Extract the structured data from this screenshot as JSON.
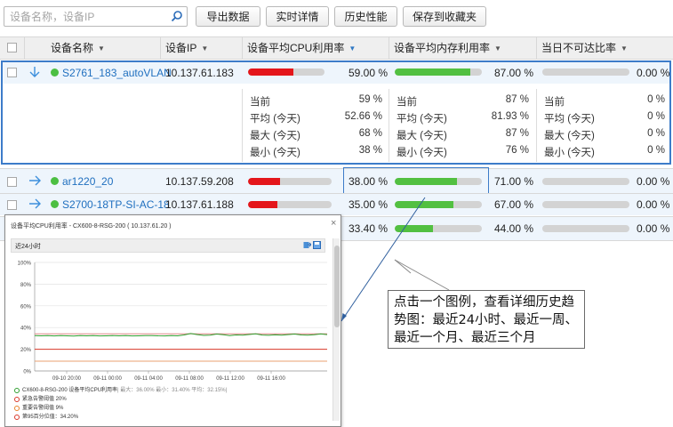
{
  "toolbar": {
    "search_placeholder": "设备名称，设备IP",
    "buttons": [
      "导出数据",
      "实时详情",
      "历史性能",
      "保存到收藏夹"
    ]
  },
  "columns": {
    "name": "设备名称",
    "ip": "设备IP",
    "cpu": "设备平均CPU利用率",
    "mem": "设备平均内存利用率",
    "unreach": "当日不可达比率"
  },
  "rows": [
    {
      "name": "S2761_183_autoVLAN",
      "ip": "10.137.61.183",
      "cpu_pct": 59,
      "cpu": "59.00 %",
      "mem_pct": 87,
      "mem": "87.00 %",
      "unreach": "0.00 %"
    },
    {
      "name": "ar1220_20",
      "ip": "10.137.59.208",
      "cpu_pct": 38,
      "cpu": "38.00 %",
      "mem_pct": 71,
      "mem": "71.00 %",
      "unreach": "0.00 %"
    },
    {
      "name": "S2700-18TP-SI-AC-18",
      "ip": "10.137.61.188",
      "cpu_pct": 35,
      "cpu": "35.00 %",
      "mem_pct": 67,
      "mem": "67.00 %",
      "unreach": "0.00 %"
    },
    {
      "cpu": "33.40 %",
      "mem_pct": 44,
      "mem": "44.00 %",
      "unreach": "0.00 %"
    }
  ],
  "details": {
    "labels": [
      "当前",
      "平均 (今天)",
      "最大 (今天)",
      "最小 (今天)"
    ],
    "cpu": [
      "59 %",
      "52.66 %",
      "68 %",
      "38 %"
    ],
    "mem": [
      "87 %",
      "81.93 %",
      "87 %",
      "76 %"
    ],
    "unreach": [
      "0 %",
      "0 %",
      "0 %",
      "0 %"
    ]
  },
  "popup": {
    "title": "设备平均CPU利用率 - CX600-8-RSG-200 ( 10.137.61.20 )",
    "close": "×",
    "tab": "近24小时",
    "legend": [
      {
        "text": "CX600-8-RSG-200 设备平均CPU利用率",
        "extra": "| 最大：36.00% 最小：31.40% 平均：32.15%|",
        "color": "#2e9e2e"
      },
      {
        "text": "紧急告警阈值 20%",
        "color": "#d9382a"
      },
      {
        "text": "重要告警阈值 9%",
        "color": "#e8822a"
      },
      {
        "text": "第95百分位值：34.20%",
        "color": "#d9382a"
      }
    ]
  },
  "chart_data": {
    "type": "line",
    "y_ticks": [
      "100%",
      "80%",
      "60%",
      "40%",
      "20%",
      "0%"
    ],
    "x_ticks": [
      "09-10 20:00",
      "09-11 00:00",
      "09-11 04:00",
      "09-11 08:00",
      "09-11 12:00",
      "09-11 16:00"
    ],
    "ylim": [
      0,
      100
    ],
    "grid": true,
    "series": [
      {
        "name": "CX600-8-RSG-200 设备平均CPU利用率",
        "color": "#2e9e2e",
        "values": [
          32.5,
          32.4,
          32.6,
          32.3,
          32.5,
          32.4,
          32.2,
          32.6,
          32.4,
          32.5,
          32.3,
          32.4,
          32.5,
          32.4,
          32.6,
          32.3,
          32.4,
          32.5,
          32.6,
          32.4,
          32.3,
          32.5,
          32.4,
          33.2,
          34.5,
          33.5,
          32.8,
          33.0,
          34.0,
          33.4,
          32.6,
          33.2,
          33.0,
          33.6,
          34.2,
          33.1,
          32.9,
          33.3,
          33.0,
          33.5,
          34.0,
          33.2,
          33.0,
          33.4,
          34.1,
          33.5
        ]
      },
      {
        "name": "紧急告警阈值",
        "color": "#d9382a",
        "values": [
          20
        ]
      },
      {
        "name": "重要告警阈值",
        "color": "#e8a070",
        "values": [
          9
        ]
      },
      {
        "name": "第95百分位值",
        "color": "#e08a8a",
        "values": [
          34.2
        ]
      }
    ]
  },
  "callout": {
    "text": "点击一个图例，查看详细历史趋势图：最近24小时、最近一周、最近一个月、最近三个月"
  },
  "colors": {
    "cpu_high": "#e4161b",
    "mem_green": "#52c041",
    "bar_bg": "#d3d3d3",
    "link": "#1f6fbf",
    "highlight_border": "#3d7cc9"
  }
}
